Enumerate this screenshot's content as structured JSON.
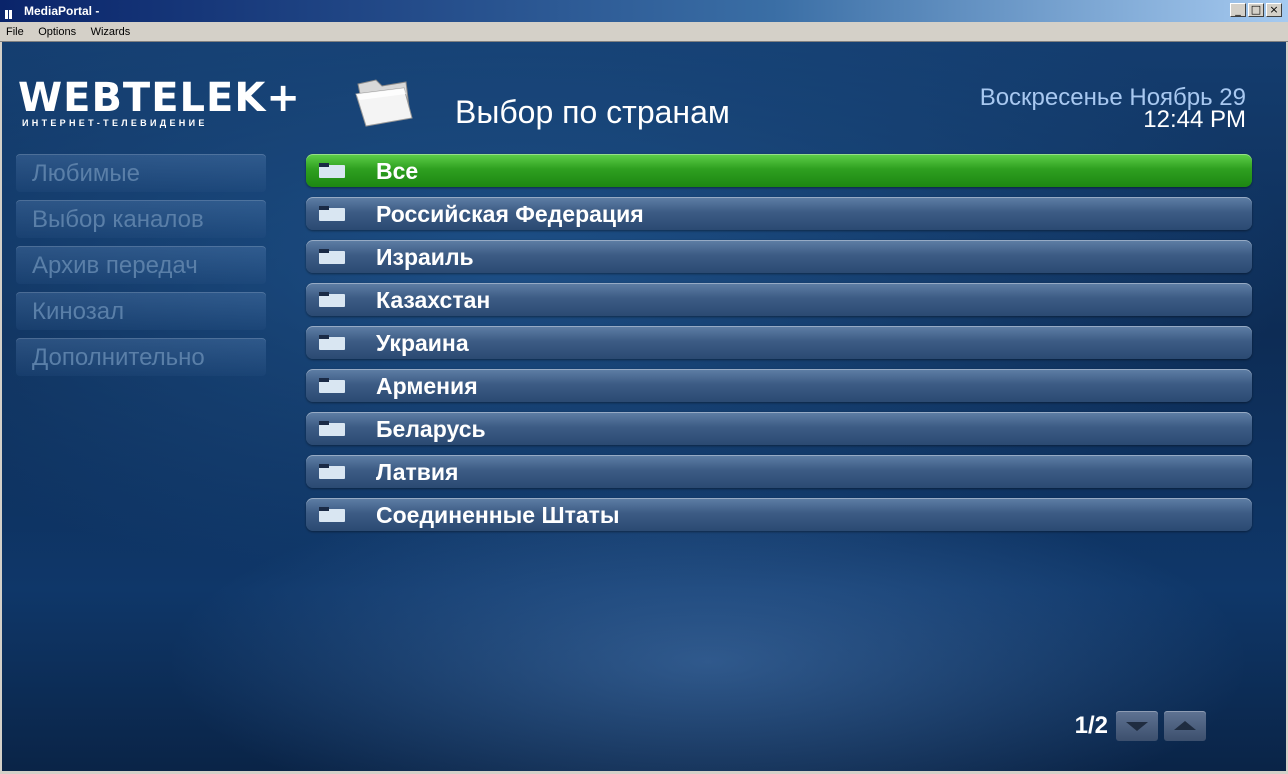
{
  "window": {
    "title": "MediaPortal -"
  },
  "menubar": {
    "items": [
      {
        "label": "File"
      },
      {
        "label": "Options"
      },
      {
        "label": "Wizards"
      }
    ]
  },
  "logo": {
    "main": "WEBTELEK+",
    "sub": "ИНТЕРНЕТ-ТЕЛЕВИДЕНИЕ"
  },
  "header": {
    "title": "Выбор по странам",
    "date": "Воскресенье Ноябрь 29",
    "time": "12:44 PM"
  },
  "side_menu": {
    "items": [
      {
        "label": "Любимые"
      },
      {
        "label": "Выбор каналов"
      },
      {
        "label": "Архив передач"
      },
      {
        "label": "Кинозал"
      },
      {
        "label": "Дополнительно"
      }
    ]
  },
  "country_list": {
    "items": [
      {
        "label": "Все",
        "selected": true
      },
      {
        "label": "Российская Федерация"
      },
      {
        "label": "Израиль"
      },
      {
        "label": "Казахстан"
      },
      {
        "label": "Украина"
      },
      {
        "label": "Армения"
      },
      {
        "label": "Беларусь"
      },
      {
        "label": "Латвия"
      },
      {
        "label": "Соединенные Штаты"
      }
    ]
  },
  "pager": {
    "text": "1/2"
  },
  "colors": {
    "selected_row": "#2fa020",
    "row": "#3d5c85",
    "date_text": "#a8c8f0"
  }
}
